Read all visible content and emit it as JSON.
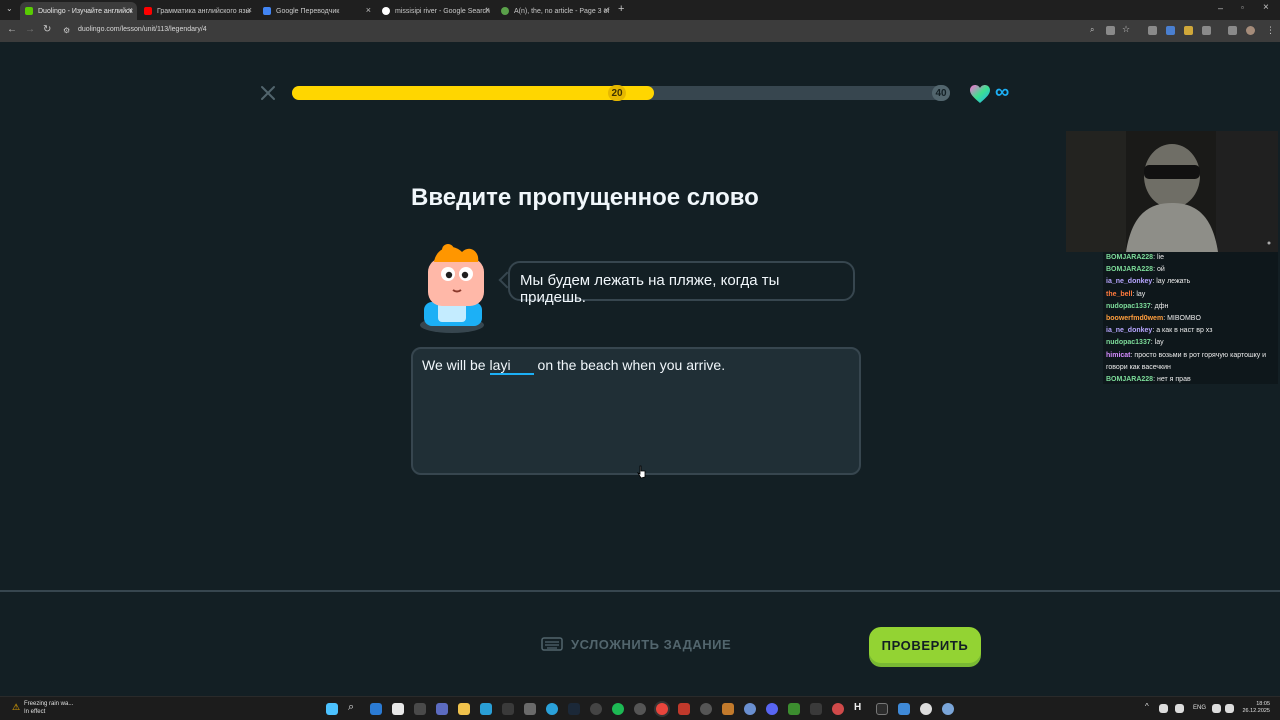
{
  "browser": {
    "tabs": [
      {
        "label": "Duolingo - Изучайте английск",
        "color": "#58cc02",
        "active": true
      },
      {
        "label": "Грамматика английского язы",
        "color": "#ff0000",
        "active": false
      },
      {
        "label": "Google Переводчик",
        "color": "#4285f4",
        "active": false
      },
      {
        "label": "missisipi river - Google Search",
        "color": "#ffffff",
        "active": false
      },
      {
        "label": "A(n), the, no article - Page 3 of",
        "color": "#5aa14a",
        "active": false
      }
    ],
    "new_tab_label": "+",
    "url": "duolingo.com/lesson/unit/113/legendary/4"
  },
  "lesson": {
    "progress_fraction": 0.55,
    "marker_start": "20",
    "marker_end": "40",
    "hearts": "∞",
    "title": "Введите пропущенное слово",
    "speech_bubble": "Мы будем лежать на пляже, когда ты придешь.",
    "sentence_before": "We will be",
    "input_value": "layi",
    "sentence_after": "on the beach when you arrive.",
    "harder_label": "УСЛОЖНИТЬ ЗАДАНИЕ",
    "check_label": "ПРОВЕРИТЬ"
  },
  "chat": [
    {
      "user": "BOMJARA228",
      "text": "lie",
      "color": "#7ddc9a"
    },
    {
      "user": "BOMJARA228",
      "text": "ой",
      "color": "#7ddc9a"
    },
    {
      "user": "ia_ne_donkey",
      "text": "lay лежать",
      "color": "#b7a6ff"
    },
    {
      "user": "the_bell",
      "text": "lay",
      "color": "#ff7a3d"
    },
    {
      "user": "nudopac1337",
      "text": "дфн",
      "color": "#7ddc9a"
    },
    {
      "user": "boowerfmd0wem",
      "text": "MIBOMBO",
      "color": "#ff9e3d"
    },
    {
      "user": "ia_ne_donkey",
      "text": "а как в наст вр хз",
      "color": "#b7a6ff"
    },
    {
      "user": "nudopac1337",
      "text": "lay",
      "color": "#7ddc9a"
    },
    {
      "user": "himicat",
      "text": "просто возьми в рот горячую картошку и говори как васечкин",
      "color": "#d58cff"
    },
    {
      "user": "BOMJARA228",
      "text": "нет я прав",
      "color": "#7ddc9a"
    }
  ],
  "taskbar": {
    "weather_line1": "Freezing rain wa...",
    "weather_line2": "In effect",
    "lang": "ENG",
    "time": "18:05",
    "date": "26.12.2025"
  }
}
